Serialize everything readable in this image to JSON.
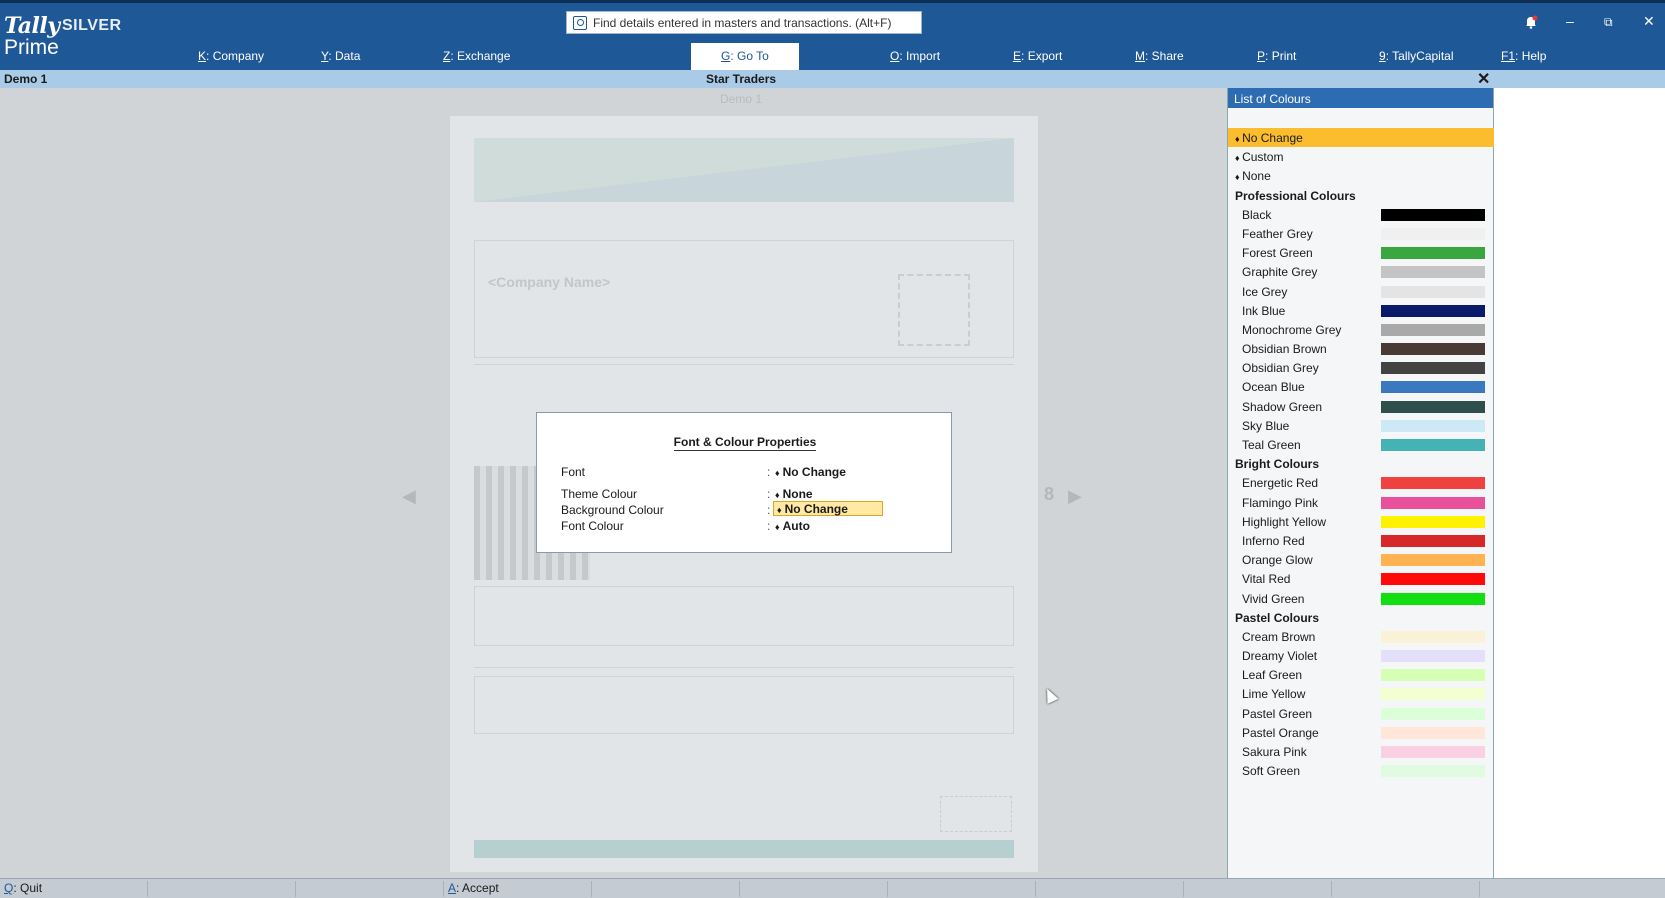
{
  "app": {
    "logo_tally": "Tally",
    "logo_prime": "Prime",
    "edition": "SILVER"
  },
  "search": {
    "placeholder": "Find details entered in masters and transactions. (Alt+F)"
  },
  "menu": [
    {
      "key": "K",
      "label": "Company"
    },
    {
      "key": "Y",
      "label": "Data"
    },
    {
      "key": "Z",
      "label": "Exchange"
    },
    {
      "key": "G",
      "label": "Go To"
    },
    {
      "key": "O",
      "label": "Import"
    },
    {
      "key": "E",
      "label": "Export"
    },
    {
      "key": "M",
      "label": "Share"
    },
    {
      "key": "P",
      "label": "Print"
    },
    {
      "key": "9",
      "label": "TallyCapital"
    },
    {
      "key": "F1",
      "label": "Help"
    }
  ],
  "window": {
    "minimize": "–",
    "restore": "⧉",
    "close": "✕"
  },
  "subheader": {
    "company": "Demo 1",
    "title": "Star Traders",
    "close": "✕"
  },
  "document": {
    "title": "Demo 1",
    "company_placeholder": "<Company Name>",
    "page_number": "8"
  },
  "dialog": {
    "title": "Font & Colour Properties",
    "fields": [
      {
        "label": "Font",
        "value": "No Change"
      },
      {
        "label": "Theme Colour",
        "value": "None"
      },
      {
        "label": "Background Colour",
        "value": "No Change"
      },
      {
        "label": "Font Colour",
        "value": "Auto"
      }
    ]
  },
  "panel": {
    "title": "List of Colours",
    "top_items": [
      "No Change",
      "Custom",
      "None"
    ],
    "groups": [
      {
        "name": "Professional Colours",
        "items": [
          {
            "name": "Black",
            "color": "#000000"
          },
          {
            "name": "Feather Grey",
            "color": "#f0f0f0"
          },
          {
            "name": "Forest Green",
            "color": "#3aa63f"
          },
          {
            "name": "Graphite Grey",
            "color": "#c4c4c4"
          },
          {
            "name": "Ice Grey",
            "color": "#e4e4e4"
          },
          {
            "name": "Ink Blue",
            "color": "#0a1a6b"
          },
          {
            "name": "Monochrome Grey",
            "color": "#a9a9a9"
          },
          {
            "name": "Obsidian Brown",
            "color": "#4a3a36"
          },
          {
            "name": "Obsidian Grey",
            "color": "#434343"
          },
          {
            "name": "Ocean Blue",
            "color": "#3a78c0"
          },
          {
            "name": "Shadow Green",
            "color": "#2f4f4c"
          },
          {
            "name": "Sky Blue",
            "color": "#cde9f6"
          },
          {
            "name": "Teal Green",
            "color": "#45b2b4"
          }
        ]
      },
      {
        "name": "Bright Colours",
        "items": [
          {
            "name": "Energetic Red",
            "color": "#f04141"
          },
          {
            "name": "Flamingo Pink",
            "color": "#e8509a"
          },
          {
            "name": "Highlight Yellow",
            "color": "#fff200"
          },
          {
            "name": "Inferno Red",
            "color": "#d62828"
          },
          {
            "name": "Orange Glow",
            "color": "#ffb350"
          },
          {
            "name": "Vital Red",
            "color": "#ff0a0a"
          },
          {
            "name": "Vivid Green",
            "color": "#12de12"
          }
        ]
      },
      {
        "name": "Pastel Colours",
        "items": [
          {
            "name": "Cream Brown",
            "color": "#fbf1d8"
          },
          {
            "name": "Dreamy Violet",
            "color": "#e4e0fb"
          },
          {
            "name": "Leaf Green",
            "color": "#d6ffb3"
          },
          {
            "name": "Lime Yellow",
            "color": "#f3ffd0"
          },
          {
            "name": "Pastel Green",
            "color": "#dbffd9"
          },
          {
            "name": "Pastel Orange",
            "color": "#ffe6d9"
          },
          {
            "name": "Sakura Pink",
            "color": "#fad0e3"
          },
          {
            "name": "Soft Green",
            "color": "#e0fbe0"
          }
        ]
      }
    ]
  },
  "footer": {
    "quit_key": "Q",
    "quit_label": "Quit",
    "accept_key": "A",
    "accept_label": "Accept"
  }
}
